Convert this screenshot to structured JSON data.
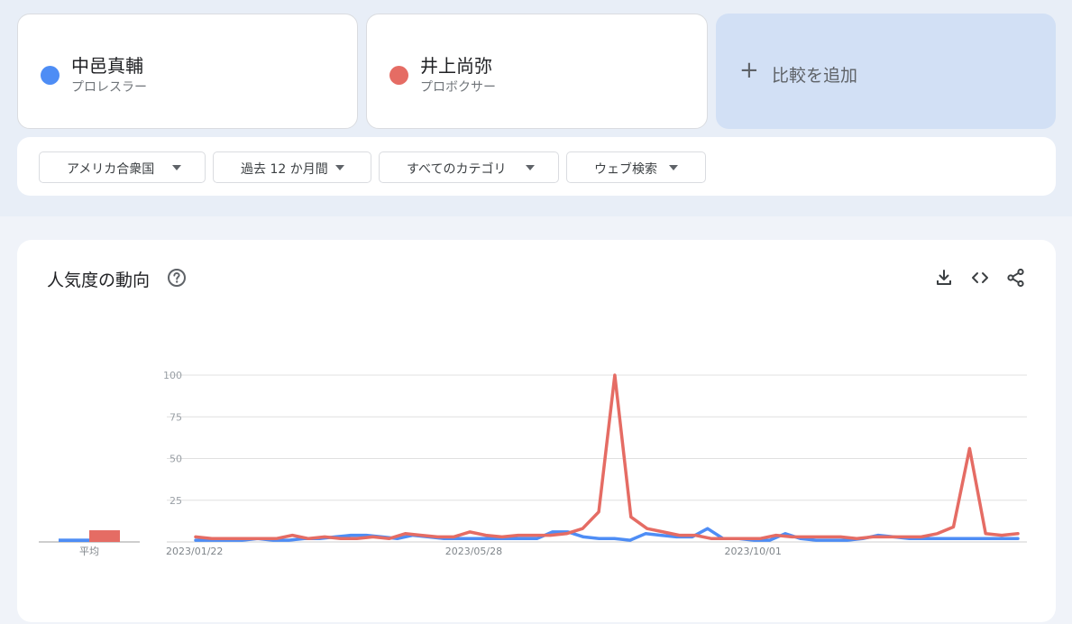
{
  "terms": [
    {
      "name": "中邑真輔",
      "category": "プロレスラー",
      "color": "#4e8df5"
    },
    {
      "name": "井上尚弥",
      "category": "プロボクサー",
      "color": "#e56c64"
    }
  ],
  "add_compare": {
    "label": "比較を追加"
  },
  "filters": {
    "region": "アメリカ合衆国",
    "period": "過去 12 か月間",
    "category": "すべてのカテゴリ",
    "search_type": "ウェブ検索"
  },
  "chart_section": {
    "title": "人気度の動向"
  },
  "chart_data": {
    "type": "line",
    "y_ticks": [
      100,
      75,
      50,
      25
    ],
    "ylim": [
      0,
      100
    ],
    "x_tick_labels": [
      {
        "index": 0,
        "label": "2023/01/22"
      },
      {
        "index": 18,
        "label": "2023/05/28"
      },
      {
        "index": 36,
        "label": "2023/10/01"
      }
    ],
    "average_label": "平均",
    "averages": [
      {
        "name": "中邑真輔",
        "value": 2
      },
      {
        "name": "井上尚弥",
        "value": 7
      }
    ],
    "series": [
      {
        "name": "中邑真輔",
        "color": "#4e8df5",
        "values": [
          1,
          1,
          1,
          1,
          2,
          1,
          1,
          2,
          2,
          3,
          4,
          4,
          3,
          2,
          4,
          3,
          2,
          2,
          2,
          2,
          2,
          2,
          2,
          6,
          6,
          3,
          2,
          2,
          1,
          5,
          4,
          3,
          3,
          8,
          2,
          2,
          1,
          1,
          5,
          2,
          1,
          1,
          1,
          2,
          4,
          3,
          2,
          2,
          2,
          2,
          2,
          2,
          2,
          2
        ]
      },
      {
        "name": "井上尚弥",
        "color": "#e56c64",
        "values": [
          3,
          2,
          2,
          2,
          2,
          2,
          4,
          2,
          3,
          2,
          2,
          3,
          2,
          5,
          4,
          3,
          3,
          6,
          4,
          3,
          4,
          4,
          4,
          5,
          8,
          18,
          100,
          15,
          8,
          6,
          4,
          4,
          2,
          2,
          2,
          2,
          4,
          3,
          3,
          3,
          3,
          2,
          3,
          3,
          3,
          3,
          5,
          9,
          56,
          5,
          4,
          5
        ]
      }
    ]
  }
}
